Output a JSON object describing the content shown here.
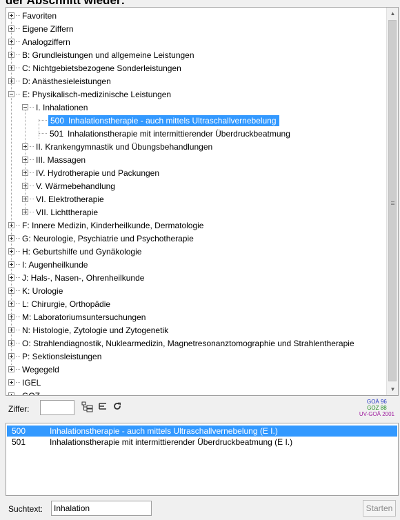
{
  "heading": "der Abschnitt wieder:",
  "tree": {
    "root_items": [
      {
        "label": "Favoriten"
      },
      {
        "label": "Eigene Ziffern"
      },
      {
        "label": "Analogziffern"
      },
      {
        "label": "B: Grundleistungen und allgemeine Leistungen"
      },
      {
        "label": "C: Nichtgebietsbezogene Sonderleistungen"
      },
      {
        "label": "D: Anästhesieleistungen"
      },
      {
        "label": "E: Physikalisch-medizinische Leistungen"
      }
    ],
    "e_children": [
      {
        "label": "I. Inhalationen"
      },
      {
        "label": "II. Krankengymnastik und Übungsbehandlungen"
      },
      {
        "label": "III. Massagen"
      },
      {
        "label": "IV. Hydrotherapie und Packungen"
      },
      {
        "label": "V. Wärmebehandlung"
      },
      {
        "label": "VI. Elektrotherapie"
      },
      {
        "label": "VII. Lichttherapie"
      }
    ],
    "inhalation_leaves": [
      {
        "code": "500",
        "label": "Inhalationstherapie - auch mittels Ultraschallvernebelung"
      },
      {
        "code": "501",
        "label": "Inhalationstherapie mit intermittierender Überdruckbeatmung"
      }
    ],
    "after_items": [
      {
        "label": "F: Innere Medizin, Kinderheilkunde, Dermatologie"
      },
      {
        "label": "G: Neurologie, Psychiatrie und Psychotherapie"
      },
      {
        "label": "H: Geburtshilfe und Gynäkologie"
      },
      {
        "label": "I: Augenheilkunde"
      },
      {
        "label": "J: Hals-, Nasen-, Ohrenheilkunde"
      },
      {
        "label": "K: Urologie"
      },
      {
        "label": "L: Chirurgie, Orthopädie"
      },
      {
        "label": "M: Laboratoriumsuntersuchungen"
      },
      {
        "label": "N: Histologie, Zytologie und Zytogenetik"
      },
      {
        "label": "O: Strahlendiagnostik, Nuklearmedizin, Magnetresonanztomographie und Strahlentherapie"
      },
      {
        "label": "P: Sektionsleistungen"
      },
      {
        "label": "Wegegeld"
      },
      {
        "label": "IGEL"
      },
      {
        "label": "GOZ"
      }
    ]
  },
  "toolbar": {
    "ziffer_label": "Ziffer:",
    "ziffer_value": "",
    "icons": [
      "tree-collapse-icon",
      "list-icon",
      "refresh-icon"
    ]
  },
  "versions": {
    "goae": "GOÄ 96",
    "goz": "GOZ 88",
    "uv_goae": "UV-GOÄ 2001"
  },
  "results": [
    {
      "code": "500",
      "text": "Inhalationstherapie - auch mittels Ultraschallvernebelung  (E I.)"
    },
    {
      "code": "501",
      "text": "Inhalationstherapie mit intermittierender Überdruckbeatmung  (E I.)"
    }
  ],
  "search": {
    "label": "Suchtext:",
    "value": "Inhalation",
    "start_button": "Starten"
  },
  "colors": {
    "selection": "#3399ff",
    "goae": "#1f33c0",
    "goz": "#1a8a1a",
    "uv_goae": "#a020a0"
  }
}
